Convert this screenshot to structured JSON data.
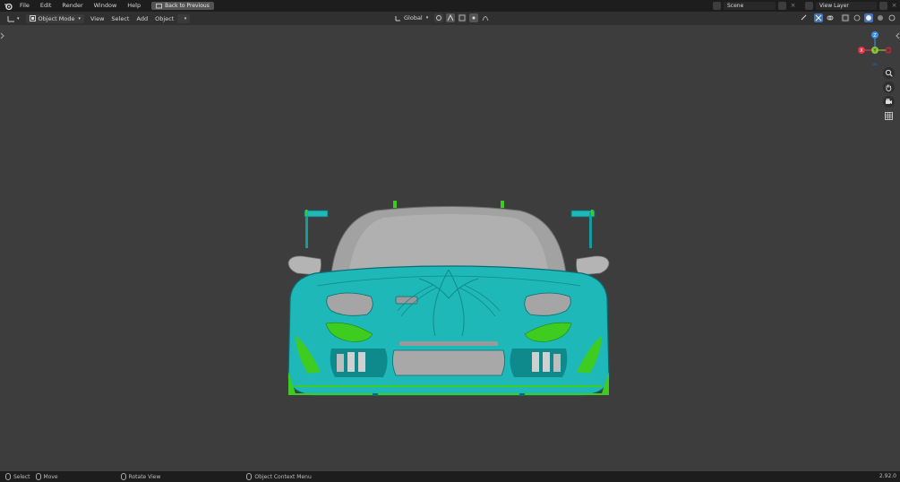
{
  "menubar": {
    "items": [
      "File",
      "Edit",
      "Render",
      "Window",
      "Help"
    ],
    "back_button": "Back to Previous",
    "scene": "Scene",
    "view_layer": "View Layer"
  },
  "header": {
    "mode": "Object Mode",
    "menus": [
      "View",
      "Select",
      "Add",
      "Object"
    ],
    "orientation": "Global"
  },
  "gizmo": {
    "axis_z": "Z",
    "axis_y": "Y",
    "axis_x": "X"
  },
  "statusbar": {
    "select": "Select",
    "move": "Move",
    "rotate": "Rotate View",
    "context": "Object Context Menu",
    "version": "2.92.0"
  },
  "colors": {
    "body": "#1fb8b8",
    "accent_green": "#3fcc20",
    "grey_parts": "#9a9a9a",
    "axis_x": "#e0344a",
    "axis_y": "#8bc436",
    "axis_z": "#3a8ce0"
  }
}
